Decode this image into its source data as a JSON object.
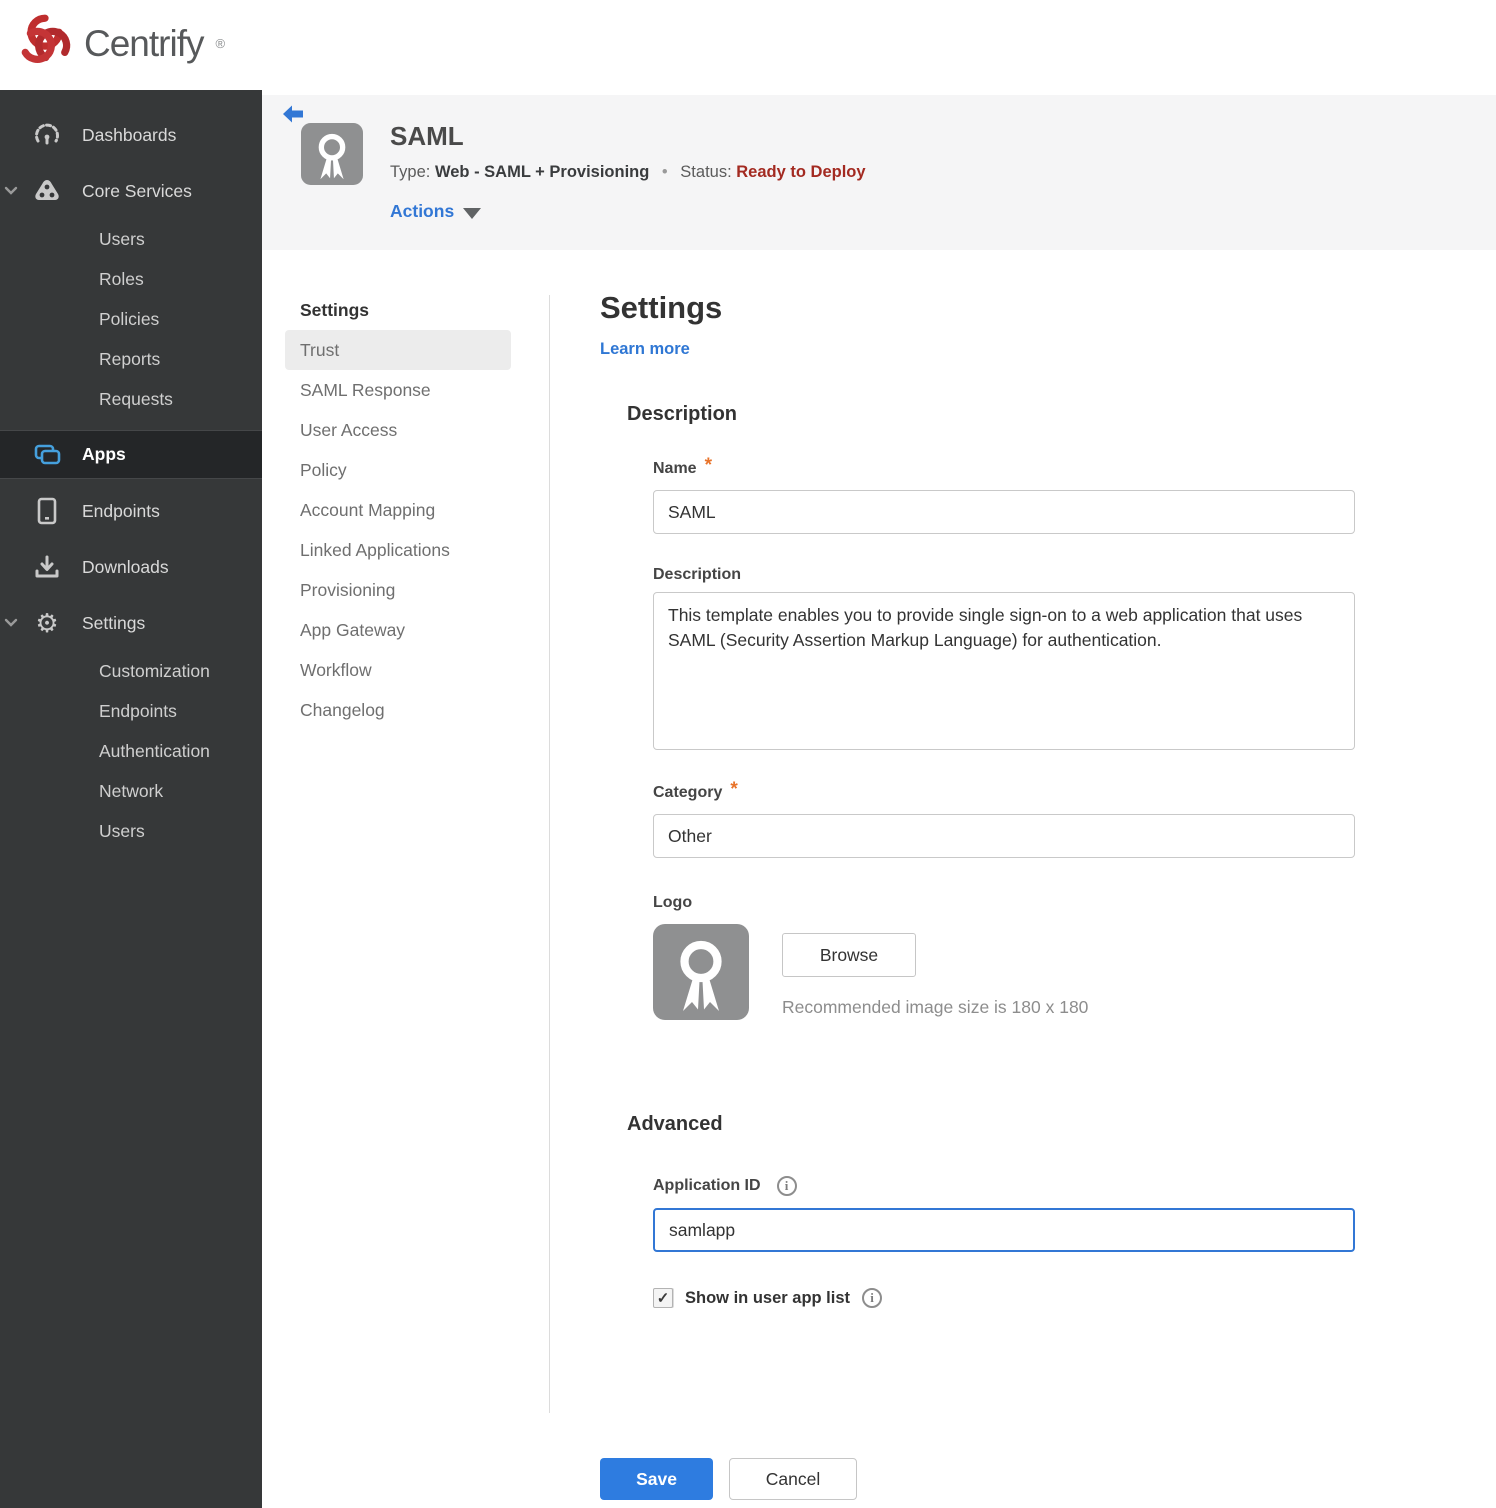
{
  "brand": {
    "name": "Centrify",
    "registered": "®"
  },
  "colors": {
    "accent_blue": "#3277d5",
    "save_blue": "#2e7ce0",
    "brand_red": "#bf2e2e",
    "status_red": "#a32a21",
    "required_orange": "#e8732a",
    "sidebar_bg": "#363839",
    "sidebar_active_bg": "#242628",
    "apps_icon_blue": "#45a0dd",
    "header_bg": "#f5f5f6"
  },
  "sidebar": {
    "items": [
      {
        "label": "Dashboards",
        "icon": "gauge-icon"
      },
      {
        "label": "Core Services",
        "icon": "core-services-icon",
        "expanded": true,
        "children": [
          "Users",
          "Roles",
          "Policies",
          "Reports",
          "Requests"
        ]
      },
      {
        "label": "Apps",
        "icon": "apps-icon",
        "active": true
      },
      {
        "label": "Endpoints",
        "icon": "device-icon"
      },
      {
        "label": "Downloads",
        "icon": "download-icon"
      },
      {
        "label": "Settings",
        "icon": "gear-icon",
        "expanded": true,
        "children": [
          "Customization",
          "Endpoints",
          "Authentication",
          "Network",
          "Users"
        ]
      }
    ]
  },
  "header": {
    "title": "SAML",
    "type_label": "Type:",
    "type_value": "Web - SAML + Provisioning",
    "separator": "•",
    "status_label": "Status:",
    "status_value": "Ready to Deploy",
    "actions_label": "Actions"
  },
  "subnav": {
    "header": "Settings",
    "items": [
      {
        "label": "Trust",
        "selected": true
      },
      {
        "label": "SAML Response"
      },
      {
        "label": "User Access"
      },
      {
        "label": "Policy"
      },
      {
        "label": "Account Mapping"
      },
      {
        "label": "Linked Applications"
      },
      {
        "label": "Provisioning"
      },
      {
        "label": "App Gateway"
      },
      {
        "label": "Workflow"
      },
      {
        "label": "Changelog"
      }
    ]
  },
  "main": {
    "title": "Settings",
    "learn_more": "Learn more",
    "required_marker": "*",
    "description_section": {
      "heading": "Description",
      "name_label": "Name",
      "name_value": "SAML",
      "description_label": "Description",
      "description_value": "This template enables you to provide single sign-on to a web application that uses SAML (Security Assertion Markup Language) for authentication.",
      "category_label": "Category",
      "category_value": "Other",
      "logo_label": "Logo",
      "browse_label": "Browse",
      "recommended_text": "Recommended image size is 180 x 180"
    },
    "advanced_section": {
      "heading": "Advanced",
      "application_id_label": "Application ID",
      "application_id_value": "samlapp",
      "show_in_user_app_list_label": "Show in user app list",
      "checkbox_checked": true
    },
    "footer": {
      "save_label": "Save",
      "cancel_label": "Cancel"
    }
  }
}
